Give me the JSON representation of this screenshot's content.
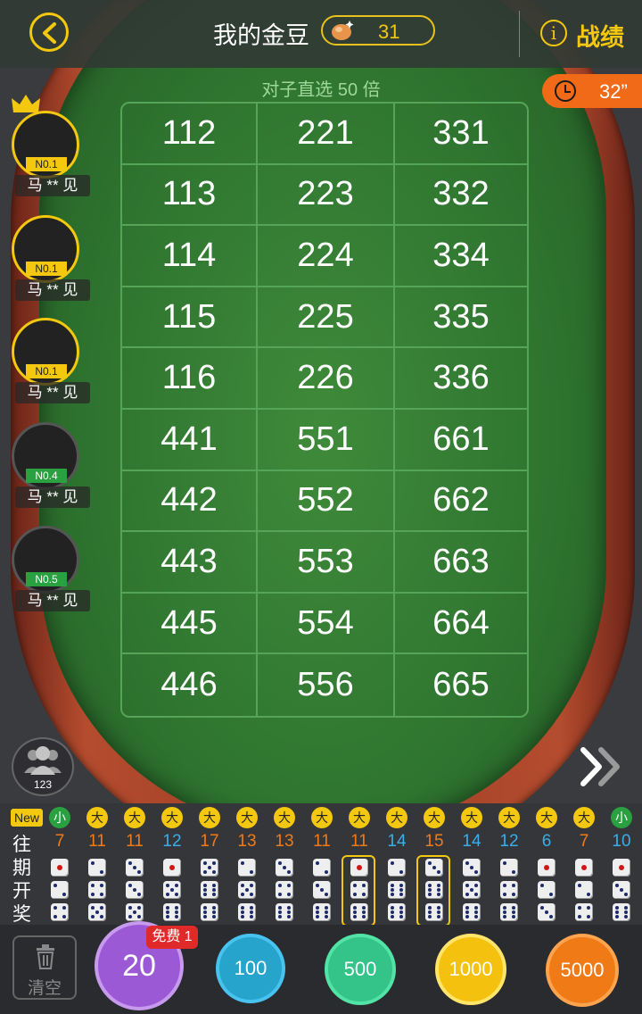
{
  "header": {
    "title": "我的金豆",
    "bean_count": "31",
    "info_glyph": "i",
    "record_label": "战绩"
  },
  "timer": {
    "text": "32”"
  },
  "bet": {
    "subtitle": "对子直选 50 倍",
    "grid": [
      [
        "112",
        "221",
        "331"
      ],
      [
        "113",
        "223",
        "332"
      ],
      [
        "114",
        "224",
        "334"
      ],
      [
        "115",
        "225",
        "335"
      ],
      [
        "116",
        "226",
        "336"
      ],
      [
        "441",
        "551",
        "661"
      ],
      [
        "442",
        "552",
        "662"
      ],
      [
        "443",
        "553",
        "663"
      ],
      [
        "445",
        "554",
        "664"
      ],
      [
        "446",
        "556",
        "665"
      ]
    ]
  },
  "players": [
    {
      "rank": "N0.1",
      "name": "马 ** 见",
      "style": "gold"
    },
    {
      "rank": "N0.1",
      "name": "马 ** 见",
      "style": "gold"
    },
    {
      "rank": "N0.1",
      "name": "马 ** 见",
      "style": "gold"
    },
    {
      "rank": "N0.4",
      "name": "马 ** 见",
      "style": "gray"
    },
    {
      "rank": "N0.5",
      "name": "马 ** 见",
      "style": "gray"
    }
  ],
  "online_count": "123",
  "history": {
    "new_label": "New",
    "label": "往期开奖",
    "rounds": [
      {
        "size": "小",
        "sum": "7",
        "dice": [
          1,
          2,
          4
        ],
        "highlight": false
      },
      {
        "size": "大",
        "sum": "11",
        "dice": [
          2,
          4,
          5
        ],
        "highlight": false
      },
      {
        "size": "大",
        "sum": "11",
        "dice": [
          3,
          3,
          5
        ],
        "highlight": false
      },
      {
        "size": "大",
        "sum": "12",
        "dice": [
          1,
          5,
          6
        ],
        "highlight": false
      },
      {
        "size": "大",
        "sum": "17",
        "dice": [
          5,
          6,
          6
        ],
        "highlight": false
      },
      {
        "size": "大",
        "sum": "13",
        "dice": [
          2,
          5,
          6
        ],
        "highlight": false
      },
      {
        "size": "大",
        "sum": "13",
        "dice": [
          3,
          4,
          6
        ],
        "highlight": false
      },
      {
        "size": "大",
        "sum": "11",
        "dice": [
          2,
          3,
          6
        ],
        "highlight": false
      },
      {
        "size": "大",
        "sum": "11",
        "dice": [
          1,
          4,
          6
        ],
        "highlight": true
      },
      {
        "size": "大",
        "sum": "14",
        "dice": [
          2,
          6,
          6
        ],
        "highlight": false
      },
      {
        "size": "大",
        "sum": "15",
        "dice": [
          3,
          6,
          6
        ],
        "highlight": true
      },
      {
        "size": "大",
        "sum": "14",
        "dice": [
          3,
          5,
          6
        ],
        "highlight": false
      },
      {
        "size": "大",
        "sum": "12",
        "dice": [
          2,
          4,
          6
        ],
        "highlight": false
      },
      {
        "size": "大",
        "sum": "6",
        "dice": [
          1,
          2,
          3
        ],
        "highlight": false
      },
      {
        "size": "大",
        "sum": "7",
        "dice": [
          1,
          2,
          4
        ],
        "highlight": false
      },
      {
        "size": "小",
        "sum": "10",
        "dice": [
          1,
          3,
          6
        ],
        "highlight": false
      }
    ]
  },
  "bottom": {
    "clear_label": "清空",
    "free_badge": "免费 1",
    "chips": [
      "20",
      "100",
      "500",
      "1000",
      "5000"
    ]
  },
  "colors": {
    "accent": "#f4c80e",
    "felt": "#2f7530",
    "timer": "#f06a17",
    "sum_orange": "#f07a16",
    "sum_blue": "#3aaee8"
  }
}
